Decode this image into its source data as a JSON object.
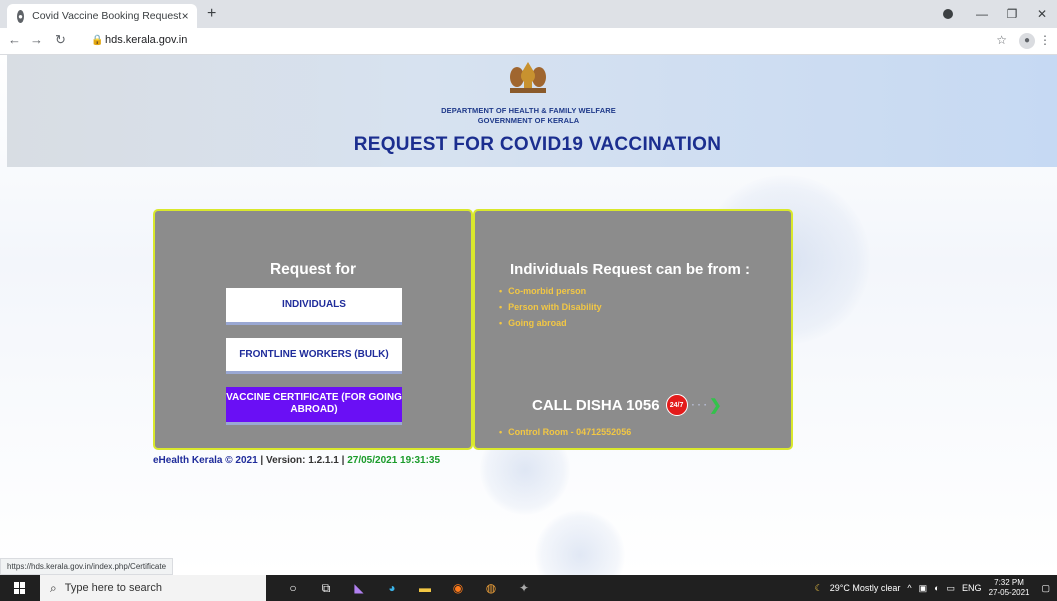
{
  "browser": {
    "tab_title": "Covid Vaccine Booking Request",
    "tab_close": "×",
    "new_tab": "+",
    "url": "hds.kerala.gov.in",
    "status_url": "https://hds.kerala.gov.in/index.php/Certificate"
  },
  "header": {
    "dept_line1": "DEPARTMENT OF HEALTH & FAMILY WELFARE",
    "dept_line2": "GOVERNMENT OF KERALA",
    "title": "REQUEST FOR COVID19 VACCINATION"
  },
  "left_panel": {
    "heading": "Request for",
    "buttons": [
      "INDIVIDUALS",
      "FRONTLINE WORKERS (BULK)",
      "VACCINE CERTIFICATE (FOR GOING ABROAD)"
    ]
  },
  "right_panel": {
    "heading": "Individuals Request can be from :",
    "items": [
      "Co-morbid person",
      "Person with Disability",
      "Going abroad"
    ],
    "call": "CALL DISHA 1056",
    "badge": "24/7",
    "dots": "· · ·",
    "chevron": "❯",
    "control": "Control Room - 04712552056"
  },
  "footer": {
    "brand": "eHealth Kerala © 2021",
    "sep": " | ",
    "version": "Version: 1.2.1.1",
    "datetime": "27/05/2021 19:31:35"
  },
  "taskbar": {
    "search_placeholder": "Type here to search",
    "weather": "29°C  Mostly clear",
    "lang": "ENG",
    "time": "7:32 PM",
    "date": "27-05-2021"
  },
  "colors": {
    "title_blue": "#1b2e8f",
    "panel_gray": "#8c8c8c",
    "panel_border": "#d9e82c",
    "purple_button": "#6a0ff5",
    "bullet_yellow": "#f2c744",
    "date_green": "#1a9b2a"
  }
}
